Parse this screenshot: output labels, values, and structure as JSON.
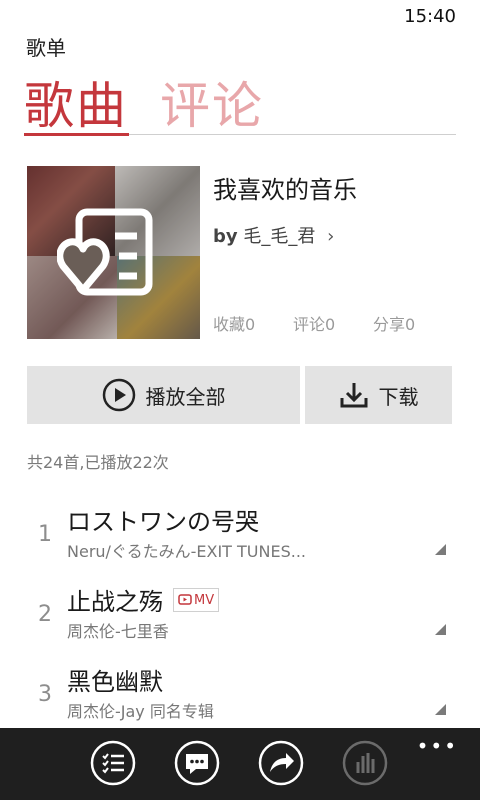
{
  "status": {
    "time": "15:40"
  },
  "app": {
    "title": "歌单"
  },
  "pivot": {
    "tabs": [
      {
        "label": "歌曲"
      },
      {
        "label": "评论"
      }
    ]
  },
  "playlist": {
    "name": "我喜欢的音乐",
    "owner_prefix": "by",
    "owner": "毛_毛_君",
    "favorites": "收藏0",
    "comments": "评论0",
    "shares": "分享0"
  },
  "actions": {
    "play_all": "播放全部",
    "download": "下载"
  },
  "summary": "共24首,已播放22次",
  "songs": [
    {
      "index": "1",
      "title": "ロストワンの号哭",
      "subtitle": "Neru/ぐるたみん-EXIT TUNES..."
    },
    {
      "index": "2",
      "title": "止战之殇",
      "subtitle": "周杰伦-七里香",
      "badge": "MV"
    },
    {
      "index": "3",
      "title": "黑色幽默",
      "subtitle": "周杰伦-Jay 同名专辑"
    }
  ],
  "appbar": {
    "icons": [
      "playlist-icon",
      "comment-icon",
      "share-icon",
      "equalizer-icon"
    ],
    "more": "•••"
  },
  "colors": {
    "accent": "#c4373c",
    "accent_light": "#e8a7aa",
    "button_bg": "#e3e3e3",
    "appbar_bg": "#1f1f1f"
  }
}
